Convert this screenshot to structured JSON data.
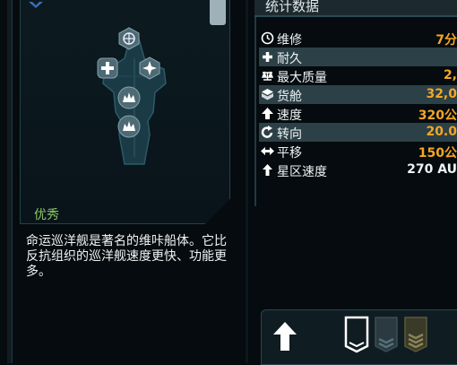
{
  "ship": {
    "quality": "优秀",
    "description": "命运巡洋舰是著名的维咔船体。它比反抗组织的巡洋舰速度更快、功能更多。"
  },
  "stats": {
    "title": "统计数据",
    "rows": [
      {
        "icon": "clock-icon",
        "label": "维修",
        "value": "7分"
      },
      {
        "icon": "cross-icon",
        "label": "耐久",
        "value": ""
      },
      {
        "icon": "weight-icon",
        "label": "最大质量",
        "value": "2,"
      },
      {
        "icon": "cargo-icon",
        "label": "货舱",
        "value": "32,0"
      },
      {
        "icon": "up-arrow-icon",
        "label": "速度",
        "value": "320公"
      },
      {
        "icon": "rotate-icon",
        "label": "转向",
        "value": "20.0"
      },
      {
        "icon": "strafe-icon",
        "label": "平移",
        "value": "150公"
      },
      {
        "icon": "up-arrow-icon",
        "label": "星区速度",
        "value": "270 AU"
      }
    ]
  },
  "colors": {
    "accent": "#f5a623",
    "quality": "#8cc665",
    "panel": "#0c1a20"
  }
}
